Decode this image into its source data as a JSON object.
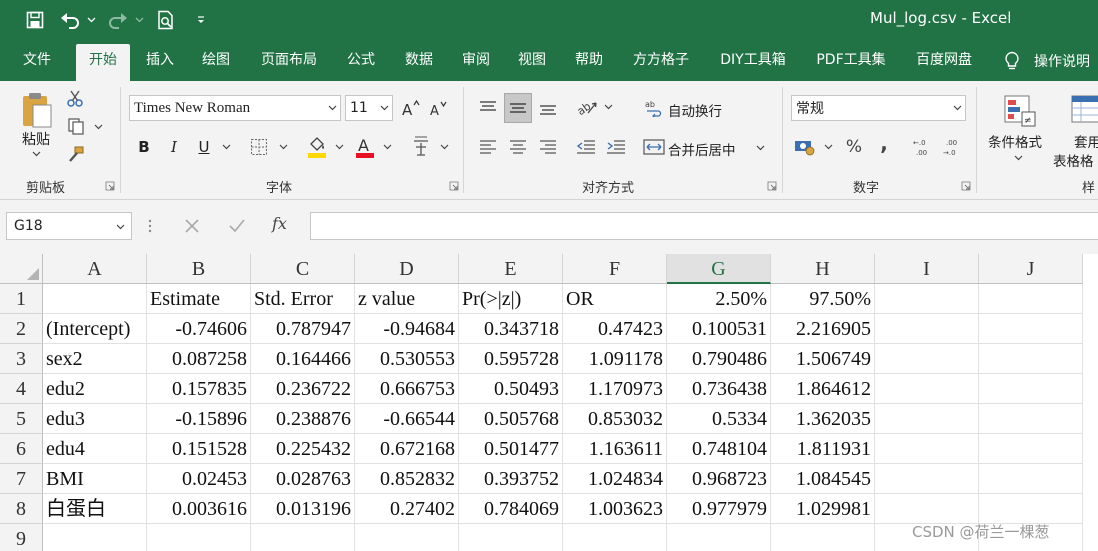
{
  "window": {
    "title": "Mul_log.csv  -  Excel"
  },
  "tabs": [
    "文件",
    "开始",
    "插入",
    "绘图",
    "页面布局",
    "公式",
    "数据",
    "审阅",
    "视图",
    "帮助",
    "方方格子",
    "DIY工具箱",
    "PDF工具集",
    "百度网盘"
  ],
  "active_tab": "开始",
  "tell_me": "操作说明",
  "ribbon": {
    "clipboard": {
      "label": "剪贴板",
      "paste": "粘贴"
    },
    "font": {
      "label": "字体",
      "name": "Times New Roman",
      "size": "11",
      "bold": "B",
      "italic": "I",
      "underline": "U",
      "font_color": "#e81123",
      "fill_color": "#ffd800"
    },
    "alignment": {
      "label": "对齐方式",
      "wrap": "自动换行",
      "merge": "合并后居中"
    },
    "number": {
      "label": "数字",
      "format": "常规",
      "percent": "%",
      "comma": ","
    },
    "styles": {
      "conditional": "条件格式",
      "table_line1": "套用",
      "table_line2": "表格格",
      "label": "样"
    }
  },
  "formula_bar": {
    "name_box": "G18",
    "fx": "fx",
    "value": ""
  },
  "columns": [
    "A",
    "B",
    "C",
    "D",
    "E",
    "F",
    "G",
    "H",
    "I",
    "J"
  ],
  "selected_column": "G",
  "rows": [
    "1",
    "2",
    "3",
    "4",
    "5",
    "6",
    "7",
    "8",
    "9"
  ],
  "cells": [
    [
      "",
      "Estimate",
      "Std. Error",
      "z value",
      "Pr(>|z|)",
      "OR",
      "2.50%",
      "97.50%",
      "",
      ""
    ],
    [
      "(Intercept)",
      "-0.74606",
      "0.787947",
      "-0.94684",
      "0.343718",
      "0.47423",
      "0.100531",
      "2.216905",
      "",
      ""
    ],
    [
      "sex2",
      "0.087258",
      "0.164466",
      "0.530553",
      "0.595728",
      "1.091178",
      "0.790486",
      "1.506749",
      "",
      ""
    ],
    [
      "edu2",
      "0.157835",
      "0.236722",
      "0.666753",
      "0.50493",
      "1.170973",
      "0.736438",
      "1.864612",
      "",
      ""
    ],
    [
      "edu3",
      "-0.15896",
      "0.238876",
      "-0.66544",
      "0.505768",
      "0.853032",
      "0.5334",
      "1.362035",
      "",
      ""
    ],
    [
      "edu4",
      "0.151528",
      "0.225432",
      "0.672168",
      "0.501477",
      "1.163611",
      "0.748104",
      "1.811931",
      "",
      ""
    ],
    [
      "BMI",
      "0.02453",
      "0.028763",
      "0.852832",
      "0.393752",
      "1.024834",
      "0.968723",
      "1.084545",
      "",
      ""
    ],
    [
      "白蛋白",
      "0.003616",
      "0.013196",
      "0.27402",
      "0.784069",
      "1.003623",
      "0.977979",
      "1.029981",
      "",
      ""
    ],
    [
      "",
      "",
      "",
      "",
      "",
      "",
      "",
      "",
      "",
      ""
    ]
  ],
  "watermark": "CSDN @荷兰一棵葱",
  "colors": {
    "accent": "#217346"
  }
}
